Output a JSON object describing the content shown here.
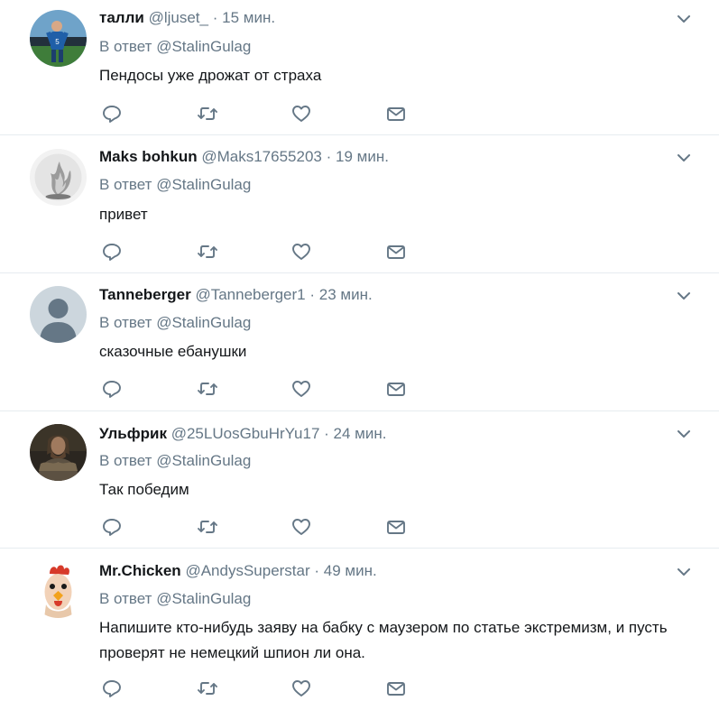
{
  "reply_prefix": "В ответ",
  "tweets": [
    {
      "name": "талли",
      "handle": "@ljuset_",
      "time": "15 мин.",
      "reply_to": "@StalinGulag",
      "text": "Пендосы уже дрожат от страха"
    },
    {
      "name": "Maks bohkun",
      "handle": "@Maks17655203",
      "time": "19 мин.",
      "reply_to": "@StalinGulag",
      "text": "привет"
    },
    {
      "name": "Tanneberger",
      "handle": "@Tanneberger1",
      "time": "23 мин.",
      "reply_to": "@StalinGulag",
      "text": "сказочные ебанушки"
    },
    {
      "name": "Ульфрик",
      "handle": "@25LUosGbuHrYu17",
      "time": "24 мин.",
      "reply_to": "@StalinGulag",
      "text": "Так победим"
    },
    {
      "name": "Mr.Chicken",
      "handle": "@AndysSuperstar",
      "time": "49 мин.",
      "reply_to": "@StalinGulag",
      "text": "Напишите кто-нибудь заяву на бабку с маузером по статье экстремизм, и пусть проверят не немецкий шпион ли она."
    }
  ],
  "separator": "·",
  "icons": {
    "reply": "reply-icon",
    "retweet": "retweet-icon",
    "like": "heart-icon",
    "dm": "envelope-icon",
    "caret": "chevron-down-icon"
  },
  "colors": {
    "text": "#14171a",
    "secondary": "#657786",
    "border": "#e6ecf0"
  }
}
